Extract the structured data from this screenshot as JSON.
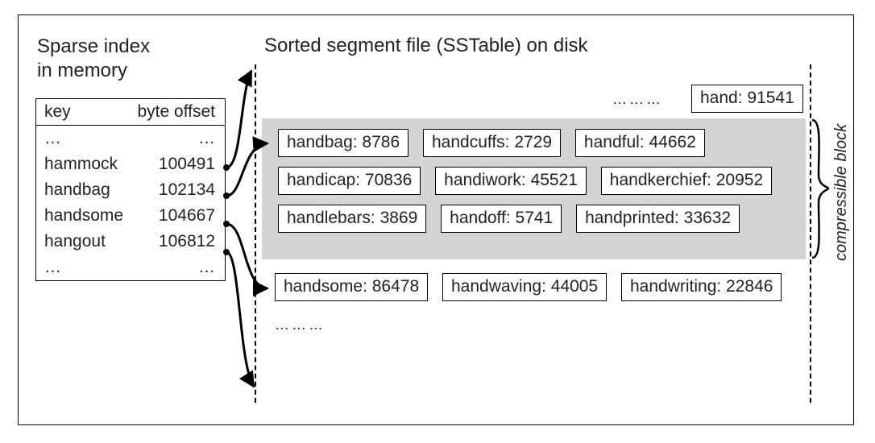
{
  "sparse": {
    "title_l1": "Sparse index",
    "title_l2": "in memory",
    "head_key": "key",
    "head_off": "byte offset",
    "rows": [
      {
        "key": "…",
        "off": "…"
      },
      {
        "key": "hammock",
        "off": "100491"
      },
      {
        "key": "handbag",
        "off": "102134"
      },
      {
        "key": "handsome",
        "off": "104667"
      },
      {
        "key": "hangout",
        "off": "106812"
      },
      {
        "key": "…",
        "off": "…"
      }
    ]
  },
  "segment": {
    "title": "Sorted segment file (SSTable) on disk",
    "top_dots": "………",
    "before_entry": "hand: 91541",
    "block_rows": [
      [
        "handbag: 8786",
        "handcuffs: 2729",
        "handful: 44662"
      ],
      [
        "handicap: 70836",
        "handiwork: 45521",
        "handkerchief: 20952"
      ],
      [
        "handlebars: 3869",
        "handoff: 5741",
        "handprinted: 33632"
      ]
    ],
    "after_row": [
      "handsome: 86478",
      "handwaving: 44005",
      "handwriting: 22846"
    ],
    "bottom_dots": "………",
    "brace_label": "compressible block"
  }
}
